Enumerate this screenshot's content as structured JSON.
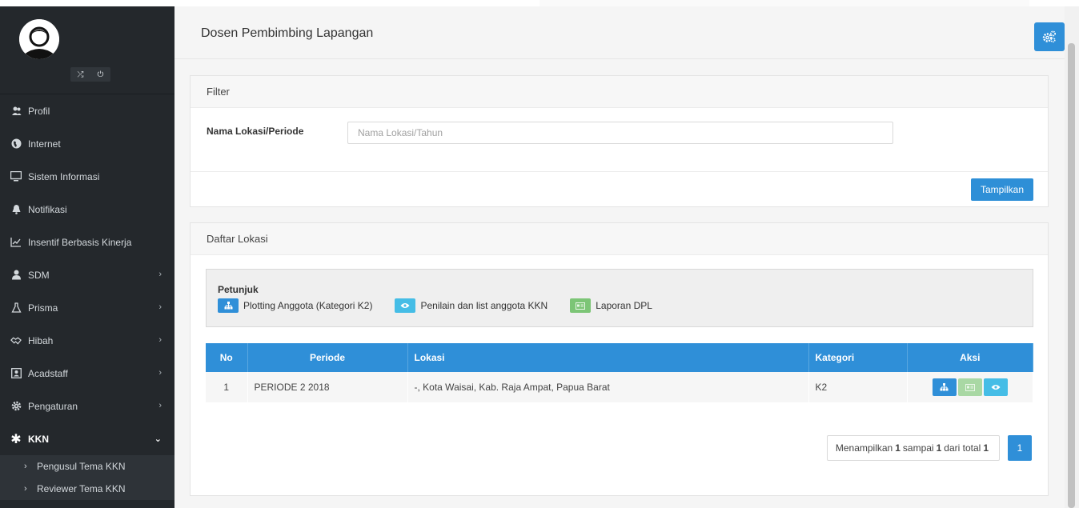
{
  "sidebar": {
    "items": [
      {
        "label": "Profil",
        "icon": "users-icon"
      },
      {
        "label": "Internet",
        "icon": "globe-icon"
      },
      {
        "label": "Sistem Informasi",
        "icon": "monitor-icon"
      },
      {
        "label": "Notifikasi",
        "icon": "bell-icon"
      },
      {
        "label": "Insentif Berbasis Kinerja",
        "icon": "chart-line-icon"
      },
      {
        "label": "SDM",
        "icon": "user-icon"
      },
      {
        "label": "Prisma",
        "icon": "flask-icon"
      },
      {
        "label": "Hibah",
        "icon": "handshake-icon"
      },
      {
        "label": "Acadstaff",
        "icon": "id-card-icon"
      },
      {
        "label": "Pengaturan",
        "icon": "cog-icon"
      },
      {
        "label": "KKN",
        "icon": "asterisk-icon"
      }
    ],
    "submenu": [
      {
        "label": "Pengusul Tema KKN"
      },
      {
        "label": "Reviewer Tema KKN"
      }
    ]
  },
  "header": {
    "title": "Dosen Pembimbing Lapangan"
  },
  "filter": {
    "heading": "Filter",
    "field_label": "Nama Lokasi/Periode",
    "placeholder": "Nama Lokasi/Tahun",
    "value": "",
    "button": "Tampilkan"
  },
  "list": {
    "heading": "Daftar Lokasi",
    "hint_title": "Petunjuk",
    "hints": [
      {
        "label": "Plotting Anggota (Kategori K2)",
        "color": "#2f8fd8",
        "icon": "sitemap-icon"
      },
      {
        "label": "Penilain dan list anggota KKN",
        "color": "#45bde6",
        "icon": "eye-icon"
      },
      {
        "label": "Laporan DPL",
        "color": "#7cc576",
        "icon": "id-card-icon"
      }
    ],
    "columns": [
      "No",
      "Periode",
      "Lokasi",
      "Kategori",
      "Aksi"
    ],
    "rows": [
      {
        "no": "1",
        "periode": "PERIODE 2 2018",
        "lokasi": "-, Kota Waisai, Kab. Raja Ampat, Papua Barat",
        "kategori": "K2"
      }
    ]
  },
  "pagination": {
    "prefix": "Menampilkan",
    "from": "1",
    "mid": "sampai",
    "to": "1",
    "suffix": "dari total",
    "total": "1",
    "current_page": "1"
  },
  "colors": {
    "accent": "#2f8fd8",
    "sidebar": "#24282c",
    "info": "#45bde6",
    "success": "#7cc576"
  }
}
